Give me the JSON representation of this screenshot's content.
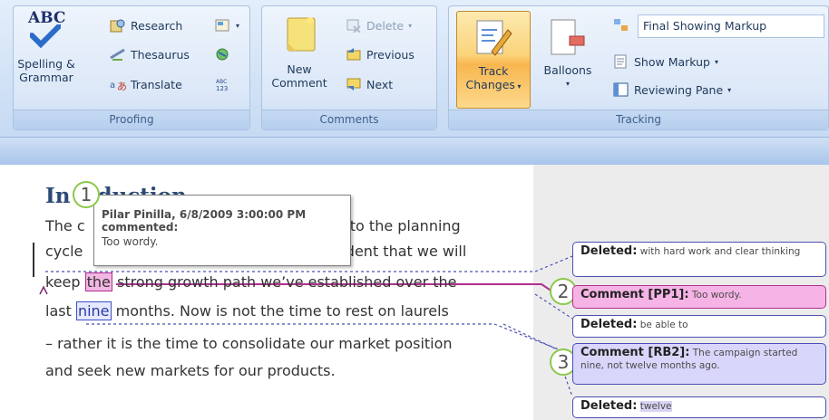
{
  "ribbon": {
    "proofing": {
      "label": "Proofing",
      "spelling_line1": "Spelling &",
      "spelling_line2": "Grammar",
      "abc": "ABC",
      "research": "Research",
      "thesaurus": "Thesaurus",
      "translate": "Translate"
    },
    "comments": {
      "label": "Comments",
      "new_line1": "New",
      "new_line2": "Comment",
      "delete": "Delete",
      "previous": "Previous",
      "next": "Next"
    },
    "tracking": {
      "label": "Tracking",
      "track_line1": "Track",
      "track_line2": "Changes",
      "balloons": "Balloons",
      "markup_select": "Final Showing Markup",
      "show_markup": "Show Markup",
      "reviewing_pane": "Reviewing Pane"
    }
  },
  "document": {
    "heading_start": "In",
    "heading_end": "duction",
    "line1_start": "The c",
    "line1_end": "nto the planning",
    "line2_start": "cycle",
    "line2_end": "ident that we will",
    "line3_pre": "keep ",
    "line3_mark": "the",
    "line3_post": " strong growth path we’ve established over the",
    "line4_pre": "last ",
    "line4_mark": "nine",
    "line4_post": " months.  Now is not the time to rest on laurels",
    "line5": "– rather it is the time to consolidate our market position",
    "line6": "and seek new markets for our products."
  },
  "tooltip": {
    "author": "Pilar Pinilla, 6/8/2009 3:00:00 PM",
    "action": "commented:",
    "text": "Too wordy."
  },
  "markers": [
    "1",
    "2",
    "3"
  ],
  "balloons": [
    {
      "kind": "Deleted:",
      "text": "with hard work and clear thinking"
    },
    {
      "kind": "Comment [PP1]:",
      "text": "Too wordy."
    },
    {
      "kind": "Deleted:",
      "text": "be able to"
    },
    {
      "kind": "Comment [RB2]:",
      "text": "The campaign started nine,  not twelve months ago."
    },
    {
      "kind": "Deleted:",
      "text": "twelve"
    }
  ],
  "colors": {
    "ribbon_text": "#1e395b",
    "comment_pink": "#f6b4e6",
    "comment_purple": "#d9d6fb",
    "callout_green": "#8cc84b",
    "track_active": "#f8b650"
  }
}
